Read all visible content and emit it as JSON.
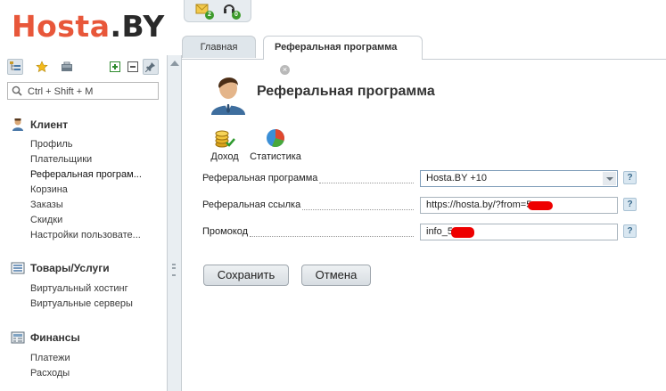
{
  "logo": {
    "part1": "Hosta",
    "part2": ".BY"
  },
  "top_icons": [
    {
      "name": "notifications-icon",
      "badge": "2"
    },
    {
      "name": "support-icon",
      "badge": "0"
    }
  ],
  "sidebar": {
    "search_placeholder": "Ctrl + Shift + M",
    "groups": [
      {
        "title": "Клиент",
        "items": [
          "Профиль",
          "Плательщики",
          "Реферальная програм...",
          "Корзина",
          "Заказы",
          "Скидки",
          "Настройки пользовате..."
        ],
        "active_index": 2
      },
      {
        "title": "Товары/Услуги",
        "items": [
          "Виртуальный хостинг",
          "Виртуальные серверы"
        ]
      },
      {
        "title": "Финансы",
        "items": [
          "Платежи",
          "Расходы"
        ]
      }
    ]
  },
  "tabs": [
    {
      "label": "Главная"
    },
    {
      "label": "Реферальная программа",
      "active": true
    }
  ],
  "page": {
    "title": "Реферальная программа",
    "actions": [
      {
        "label": "Доход"
      },
      {
        "label": "Статистика"
      }
    ],
    "form": [
      {
        "label": "Реферальная программа",
        "value": "Hosta.BY +10",
        "type": "select"
      },
      {
        "label": "Реферальная ссылка",
        "value": "https://hosta.by/?from=5",
        "type": "text"
      },
      {
        "label": "Промокод",
        "value": "info_5",
        "type": "text"
      }
    ],
    "help_label": "?",
    "buttons": {
      "save": "Сохранить",
      "cancel": "Отмена"
    }
  },
  "colors": {
    "logo_accent": "#e8573a",
    "redaction": "#e00000"
  }
}
